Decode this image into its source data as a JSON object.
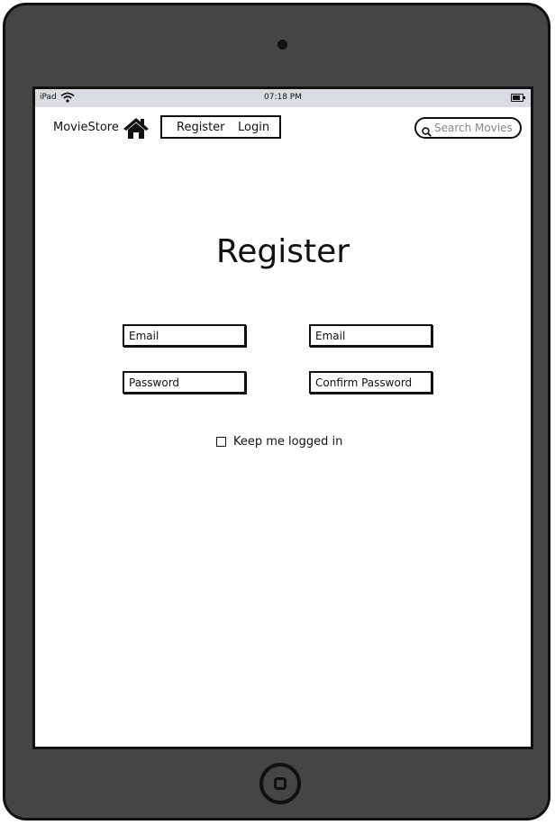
{
  "status_bar": {
    "carrier": "iPad",
    "time": "07:18 PM"
  },
  "nav": {
    "brand": "MovieStore",
    "register_label": "Register",
    "login_label": "Login",
    "search_placeholder": "Search Movies"
  },
  "page": {
    "title": "Register"
  },
  "form": {
    "email_placeholder": "Email",
    "email2_placeholder": "Email",
    "password_placeholder": "Password",
    "confirm_password_placeholder": "Confirm Password",
    "keep_logged_in_label": "Keep me logged in",
    "keep_logged_in_checked": false
  },
  "icons": {
    "home": "home-icon",
    "search": "search-icon",
    "wifi": "wifi-icon",
    "battery": "battery-icon"
  },
  "colors": {
    "device_frame": "#454545",
    "status_bar": "#d9dde1",
    "ink": "#111111"
  }
}
